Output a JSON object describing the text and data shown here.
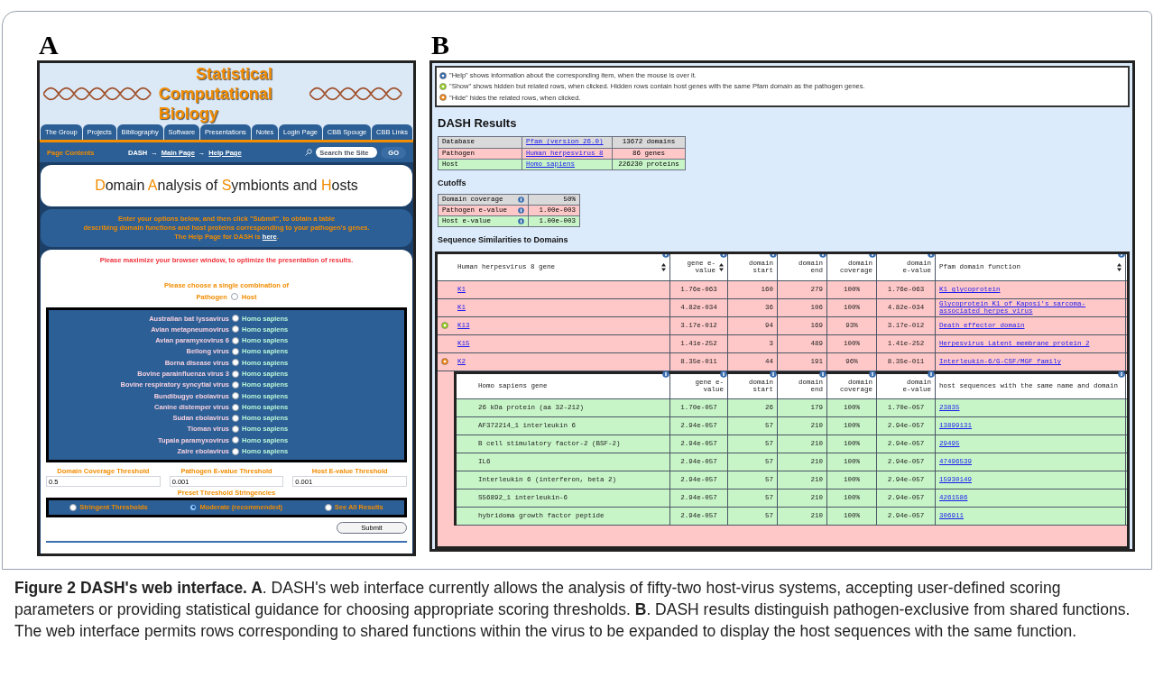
{
  "panel_labels": [
    "A",
    "B"
  ],
  "panel_a": {
    "site_title": [
      "Statistical",
      "Computational Biology"
    ],
    "nav_tabs": [
      {
        "label": "The Group"
      },
      {
        "label": "Projects"
      },
      {
        "label": "Bibliography"
      },
      {
        "label": "Software"
      },
      {
        "label": "Presentations"
      },
      {
        "label": "Notes"
      },
      {
        "label": "Login Page"
      },
      {
        "label": "CBB Spouge"
      },
      {
        "label": "CBB Links"
      }
    ],
    "page_contents": "Page Contents",
    "breadcrumb_separator": "→",
    "breadcrumb": [
      {
        "label": "DASH",
        "link": false
      },
      {
        "label": "Main Page",
        "link": true
      },
      {
        "label": "Help Page",
        "link": true
      }
    ],
    "search": {
      "placeholder": "Search the Site"
    },
    "go": "GO",
    "heading": [
      {
        "text": "D",
        "accent": true
      },
      {
        "text": "omain ",
        "accent": false
      },
      {
        "text": "A",
        "accent": true
      },
      {
        "text": "nalysis of ",
        "accent": false
      },
      {
        "text": "S",
        "accent": true
      },
      {
        "text": "ymbionts and ",
        "accent": false
      },
      {
        "text": "H",
        "accent": true
      },
      {
        "text": "osts",
        "accent": false
      }
    ],
    "intro": [
      "Enter your options below, and then click \"Submit\", to obtain a table",
      "describing domain functions and host proteins corresponding to your pathogen's genes."
    ],
    "help_line": {
      "before": "The Help Page for DASH is ",
      "link": "here",
      "after": "."
    },
    "warning": "Please maximize your browser window, to optimize the presentation of results.",
    "choose": "Please choose a single combination of",
    "pathogen_label": "Pathogen",
    "host_label": "Host",
    "header_radio_selected": false,
    "pairs": [
      {
        "pathogen": "Australian bat lyssavirus",
        "host": "Homo sapiens",
        "selected": false
      },
      {
        "pathogen": "Avian metapneumovirus",
        "host": "Homo sapiens",
        "selected": false
      },
      {
        "pathogen": "Avian paramyxovirus 6",
        "host": "Homo sapiens",
        "selected": false
      },
      {
        "pathogen": "Beilong virus",
        "host": "Homo sapiens",
        "selected": false
      },
      {
        "pathogen": "Borna disease virus",
        "host": "Homo sapiens",
        "selected": false
      },
      {
        "pathogen": "Bovine parainfluenza virus 3",
        "host": "Homo sapiens",
        "selected": false
      },
      {
        "pathogen": "Bovine respiratory syncytial virus",
        "host": "Homo sapiens",
        "selected": false
      },
      {
        "pathogen": "Bundibugyo ebolavirus",
        "host": "Homo sapiens",
        "selected": false
      },
      {
        "pathogen": "Canine distemper virus",
        "host": "Homo sapiens",
        "selected": false
      },
      {
        "pathogen": "Sudan ebolavirus",
        "host": "Homo sapiens",
        "selected": false
      },
      {
        "pathogen": "Tioman virus",
        "host": "Homo sapiens",
        "selected": false
      },
      {
        "pathogen": "Tupaia paramyxovirus",
        "host": "Homo sapiens",
        "selected": false
      },
      {
        "pathogen": "Zaire ebolavirus",
        "host": "Homo sapiens",
        "selected": false
      }
    ],
    "thresholds": [
      {
        "label": "Domain Coverage Threshold",
        "value": "0.5"
      },
      {
        "label": "Pathogen E-value Threshold",
        "value": "0.001"
      },
      {
        "label": "Host E-value Threshold",
        "value": "0.001"
      }
    ],
    "preset_title": "Preset Threshold Stringencies",
    "presets": [
      {
        "label": "Stringent Thresholds",
        "selected": false
      },
      {
        "label": "Moderate (recommended)",
        "selected": true
      },
      {
        "label": "See All Results",
        "selected": false
      }
    ],
    "submit": "Submit"
  },
  "panel_b": {
    "legend": [
      {
        "kind": "help",
        "text": "\"Help\" shows information about the corresponding item, when the mouse is over it."
      },
      {
        "kind": "show",
        "text": "\"Show\" shows hidden but related rows, when clicked. Hidden rows contain host genes with the same Pfam domain as the pathogen genes."
      },
      {
        "kind": "hide",
        "text": "\"Hide\" hides the related rows, when clicked."
      }
    ],
    "title": "DASH Results",
    "summary": [
      {
        "kind": "database",
        "label": "Database",
        "link": "Pfam (version 26.0)",
        "count": "13672 domains"
      },
      {
        "kind": "pathogen",
        "label": "Pathogen",
        "link": "Human herpesvirus 8",
        "count": "86 genes"
      },
      {
        "kind": "host",
        "label": "Host",
        "link": "Homo sapiens",
        "count": "226230 proteins"
      }
    ],
    "cutoffs_title": "Cutoffs",
    "cutoffs": [
      {
        "kind": "database",
        "label": "Domain coverage",
        "value": "50%"
      },
      {
        "kind": "pathogen",
        "label": "Pathogen e-value",
        "value": "1.00e-003"
      },
      {
        "kind": "host",
        "label": "Host e-value",
        "value": "1.00e-003"
      }
    ],
    "similarities_title": "Sequence Similarities to Domains",
    "table": {
      "columns": [
        {
          "label": "Human herpesvirus 8 gene",
          "sortable": true
        },
        {
          "label": "gene e-value",
          "sortable": true
        },
        {
          "label": "domain start",
          "sortable": false
        },
        {
          "label": "domain end",
          "sortable": false
        },
        {
          "label": "domain coverage",
          "sortable": false
        },
        {
          "label": "domain e-value",
          "sortable": false
        },
        {
          "label": "Pfam domain function",
          "sortable": true
        }
      ],
      "rows": [
        {
          "kind": "plain",
          "cells": [
            "K1",
            "1.76e-063",
            "160",
            "279",
            "100%",
            "1.76e-063",
            "K1 glycoprotein"
          ]
        },
        {
          "kind": "plain",
          "cells": [
            "K1",
            "4.82e-034",
            "36",
            "106",
            "100%",
            "4.82e-034",
            "Glycoprotein K1 of Kaposi's sarcoma-associated herpes virus"
          ]
        },
        {
          "kind": "show",
          "cells": [
            "K13",
            "3.17e-012",
            "94",
            "169",
            "93%",
            "3.17e-012",
            "Death effector domain"
          ]
        },
        {
          "kind": "plain",
          "cells": [
            "K15",
            "1.41e-252",
            "3",
            "489",
            "100%",
            "1.41e-252",
            "Herpesvirus Latent membrane protein 2"
          ]
        },
        {
          "kind": "hide",
          "cells": [
            "K2",
            "8.35e-011",
            "44",
            "191",
            "96%",
            "8.35e-011",
            "Interleukin-6/G-CSF/MGF family"
          ]
        }
      ]
    },
    "host_table": {
      "columns": [
        "Homo sapiens gene",
        "gene e-value",
        "domain start",
        "domain end",
        "domain coverage",
        "domain e-value",
        "host sequences with the same name and domain"
      ],
      "rows": [
        [
          "26 kDa protein (aa 32-212)",
          "1.70e-057",
          "26",
          "179",
          "100%",
          "1.70e-057",
          "23835"
        ],
        [
          "AF372214_1 interleukin 6",
          "2.94e-057",
          "57",
          "210",
          "100%",
          "2.94e-057",
          "13899131"
        ],
        [
          "B cell stimulatory factor-2 (BSF-2)",
          "2.94e-057",
          "57",
          "210",
          "100%",
          "2.94e-057",
          "29495"
        ],
        [
          "IL6",
          "2.94e-057",
          "57",
          "210",
          "100%",
          "2.94e-057",
          "47496539"
        ],
        [
          "Interleukin 6 (interferon, beta 2)",
          "2.94e-057",
          "57",
          "210",
          "100%",
          "2.94e-057",
          "15930149"
        ],
        [
          "S56892_1 interleukin-6",
          "2.94e-057",
          "57",
          "210",
          "100%",
          "2.94e-057",
          "4261586"
        ],
        [
          "hybridoma growth factor peptide",
          "2.94e-057",
          "57",
          "210",
          "100%",
          "2.94e-057",
          "306911"
        ]
      ]
    }
  },
  "caption": "**Figure 2 DASH's web interface. A**. DASH's web interface currently allows the analysis of fifty-two host-virus systems, accepting user-defined scoring parameters or providing statistical guidance for choosing appropriate scoring thresholds. **B**. DASH results distinguish pathogen-exclusive from shared functions. The web interface permits rows corresponding to shared functions within the virus to be expanded to display the host sequences with the same function."
}
